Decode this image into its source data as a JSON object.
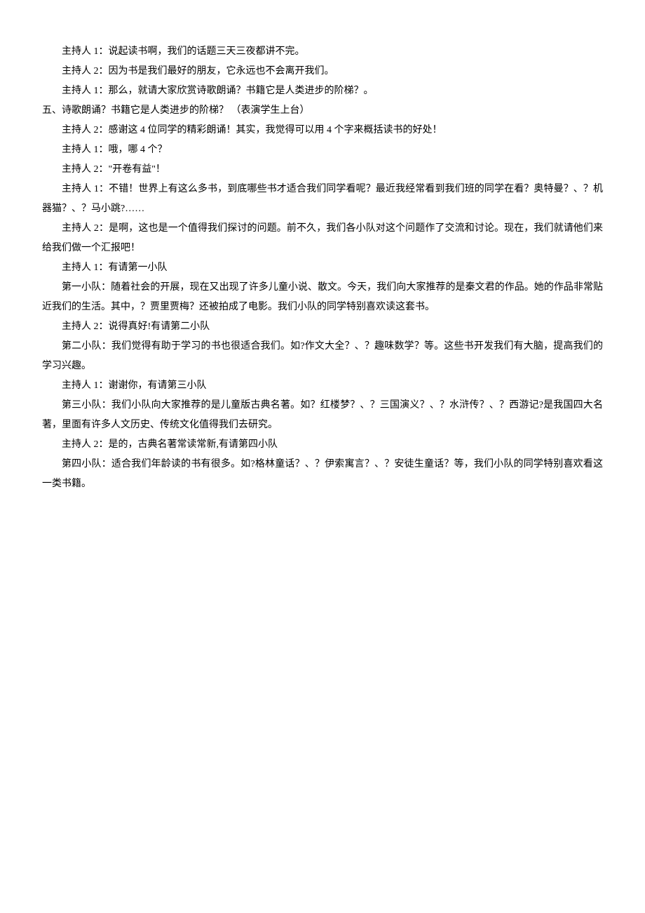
{
  "lines": {
    "l1": "主持人 1：说起读书啊，我们的话题三天三夜都讲不完。",
    "l2": "主持人 2：因为书是我们最好的朋友，它永远也不会离开我们。",
    "l3": "主持人 1：那么，就请大家欣赏诗歌朗诵？书籍它是人类进步的阶梯？。",
    "l4": "五、诗歌朗诵？书籍它是人类进步的阶梯？ （表演学生上台）",
    "l5": "主持人 2：感谢这 4 位同学的精彩朗诵！其实，我觉得可以用 4 个字来概括读书的好处！",
    "l6": "主持人 1：哦，哪 4 个？",
    "l7": "主持人 2：\"开卷有益\"！",
    "l8": "主持人 1：不错！世界上有这么多书，到底哪些书才适合我们同学看呢？最近我经常看到我们班的同学在看？奥特曼？、？机器猫？、？马小跳?……",
    "l9": "主持人 2：是啊，这也是一个值得我们探讨的问题。前不久，我们各小队对这个问题作了交流和讨论。现在，我们就请他们来给我们做一个汇报吧！",
    "l10": "主持人 1：有请第一小队",
    "l11": "第一小队：随着社会的开展，现在又出现了许多儿童小说、散文。今天，我们向大家推荐的是秦文君的作品。她的作品非常贴近我们的生活。其中，？贾里贾梅？还被拍成了电影。我们小队的同学特别喜欢读这套书。",
    "l12": "主持人 2：说得真好!有请第二小队",
    "l13": "第二小队：我们觉得有助于学习的书也很适合我们。如?作文大全？、？趣味数学？等。这些书开发我们有大脑，提高我们的学习兴趣。",
    "l14": "主持人 1：谢谢你，有请第三小队",
    "l15": "第三小队：我们小队向大家推荐的是儿童版古典名著。如？红楼梦？、？三国演义？、？水浒传？、？西游记?是我国四大名著，里面有许多人文历史、传统文化值得我们去研究。",
    "l16": "主持人 2：是的，古典名著常读常新,有请第四小队",
    "l17": "第四小队：适合我们年龄读的书有很多。如?格林童话？、？伊索寓言？、？安徒生童话？等，我们小队的同学特别喜欢看这一类书籍。"
  }
}
